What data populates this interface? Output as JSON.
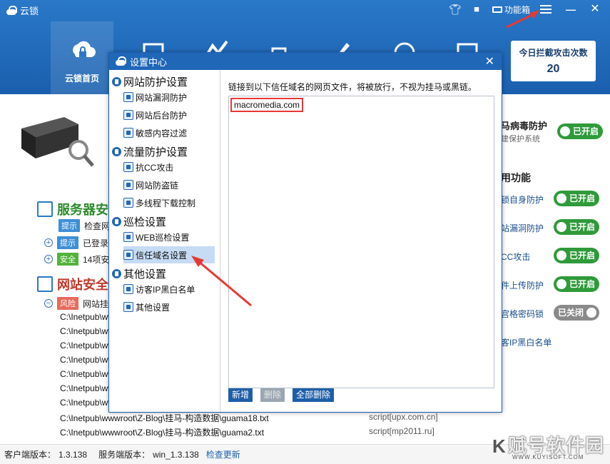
{
  "app": {
    "title": "云锁",
    "func_box_label": "功能箱"
  },
  "nav": {
    "home_label": "云锁首页"
  },
  "intercept": {
    "label": "今日拦截攻击次数",
    "count": "20"
  },
  "background": {
    "server_section": "服务器安",
    "rows": [
      {
        "tag": "提示",
        "text": "检查网"
      },
      {
        "tag": "提示",
        "text": "已登录"
      },
      {
        "tag": "安全",
        "text": "14项安"
      }
    ],
    "site_section": "网站安全",
    "risk_row": {
      "tag": "风险",
      "text": "网站挂"
    },
    "paths": [
      "C:\\Inetpub\\ww",
      "C:\\Inetpub\\ww",
      "C:\\Inetpub\\ww",
      "C:\\Inetpub\\ww",
      "C:\\Inetpub\\ww",
      "C:\\Inetpub\\ww",
      "C:\\Inetpub\\ww",
      "C:\\Inetpub\\wwwroot\\Z-Blog\\挂马-构造数据\\guama18.txt",
      "C:\\Inetpub\\wwwroot\\Z-Blog\\挂马-构造数据\\guama2.txt"
    ],
    "scripts": [
      "script[upx.com.cn]",
      "script[mp2011.ru]"
    ]
  },
  "right_panel": {
    "virus_title": "马病毒防护",
    "virus_sub": "建保护系统",
    "virus_toggle": "已开启",
    "common_title": "用功能",
    "items": [
      {
        "label": "锁自身防护",
        "toggle": "已开启"
      },
      {
        "label": "站漏洞防护",
        "toggle": "已开启"
      },
      {
        "label": "CC攻击",
        "toggle": "已开启"
      },
      {
        "label": "件上传防护",
        "toggle": "已开启"
      },
      {
        "label": "宫格密码锁",
        "toggle": "已关闭"
      },
      {
        "label": "客IP黑白名单",
        "toggle": ""
      }
    ]
  },
  "status": {
    "client_version_label": "客户端版本：",
    "client_version": "1.3.138",
    "server_version_label": "服务端版本：",
    "server_version": "win_1.3.138",
    "update_link": "检查更新"
  },
  "watermark": {
    "text": "赋号软件园",
    "url": "WWW.KUYISOFT.COM"
  },
  "dialog": {
    "title": "设置中心",
    "groups": [
      {
        "label": "网站防护设置",
        "items": [
          "网站漏洞防护",
          "网站后台防护",
          "敏感内容过滤"
        ]
      },
      {
        "label": "流量防护设置",
        "items": [
          "抗CC攻击",
          "网站防盗链",
          "多线程下载控制"
        ]
      },
      {
        "label": "巡检设置",
        "items": [
          "WEB巡检设置",
          "信任域名设置"
        ]
      },
      {
        "label": "其他设置",
        "items": [
          "访客IP黑白名单",
          "其他设置"
        ]
      }
    ],
    "active_item": "信任域名设置",
    "description": "链接到以下信任域名的网页文件，将被放行，不视为挂马或黑链。",
    "domains": [
      "macromedia.com"
    ],
    "buttons": {
      "add": "新增",
      "delete": "删除",
      "delete_all": "全部删除"
    }
  }
}
